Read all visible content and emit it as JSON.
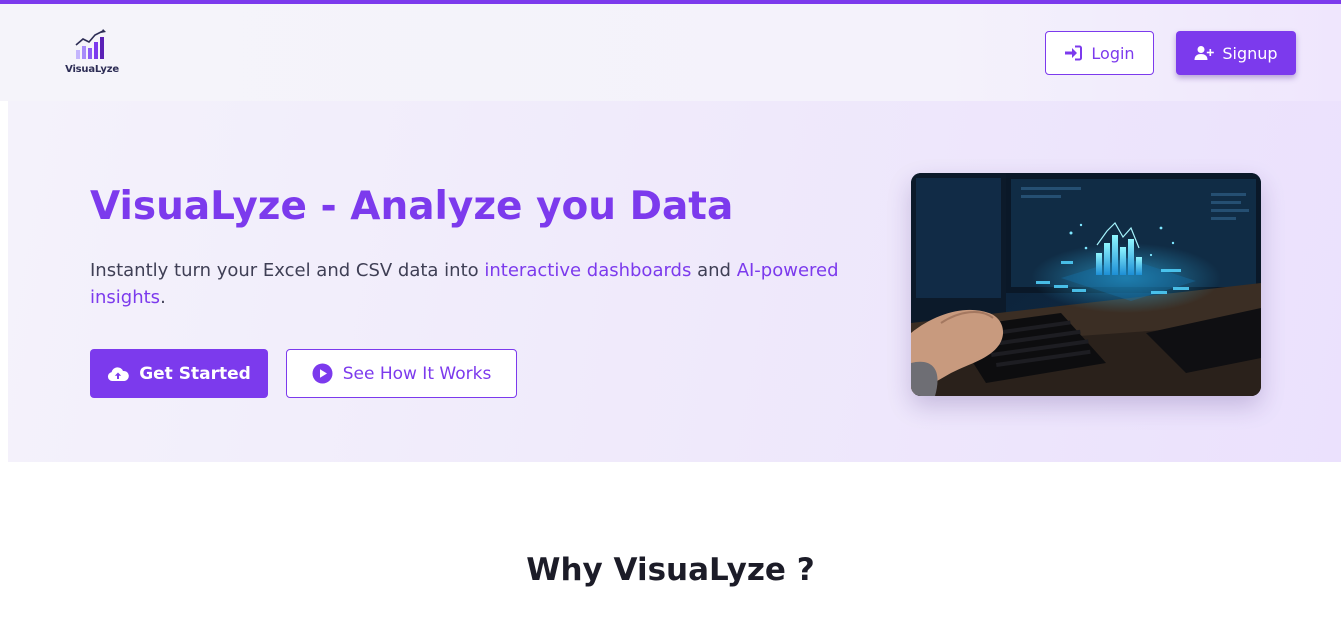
{
  "header": {
    "logo_text": "VisuaLyze",
    "login_label": "Login",
    "signup_label": "Signup"
  },
  "hero": {
    "title": "VisuaLyze - Analyze you Data",
    "subtitle_part1": "Instantly turn your Excel and CSV data into ",
    "subtitle_highlight1": "interactive dashboards",
    "subtitle_part2": " and ",
    "subtitle_highlight2": "AI-powered insights",
    "subtitle_part3": ".",
    "get_started_label": "Get Started",
    "see_how_label": "See How It Works"
  },
  "why": {
    "heading": "Why VisuaLyze ?"
  },
  "colors": {
    "accent": "#7c3aed",
    "accent_dark": "#6d28d9",
    "text": "#3f3f55"
  },
  "icons": {
    "logo": "bar-chart-logo-icon",
    "login": "sign-in-icon",
    "signup": "user-plus-icon",
    "get_started": "cloud-upload-icon",
    "see_how": "play-circle-icon"
  }
}
